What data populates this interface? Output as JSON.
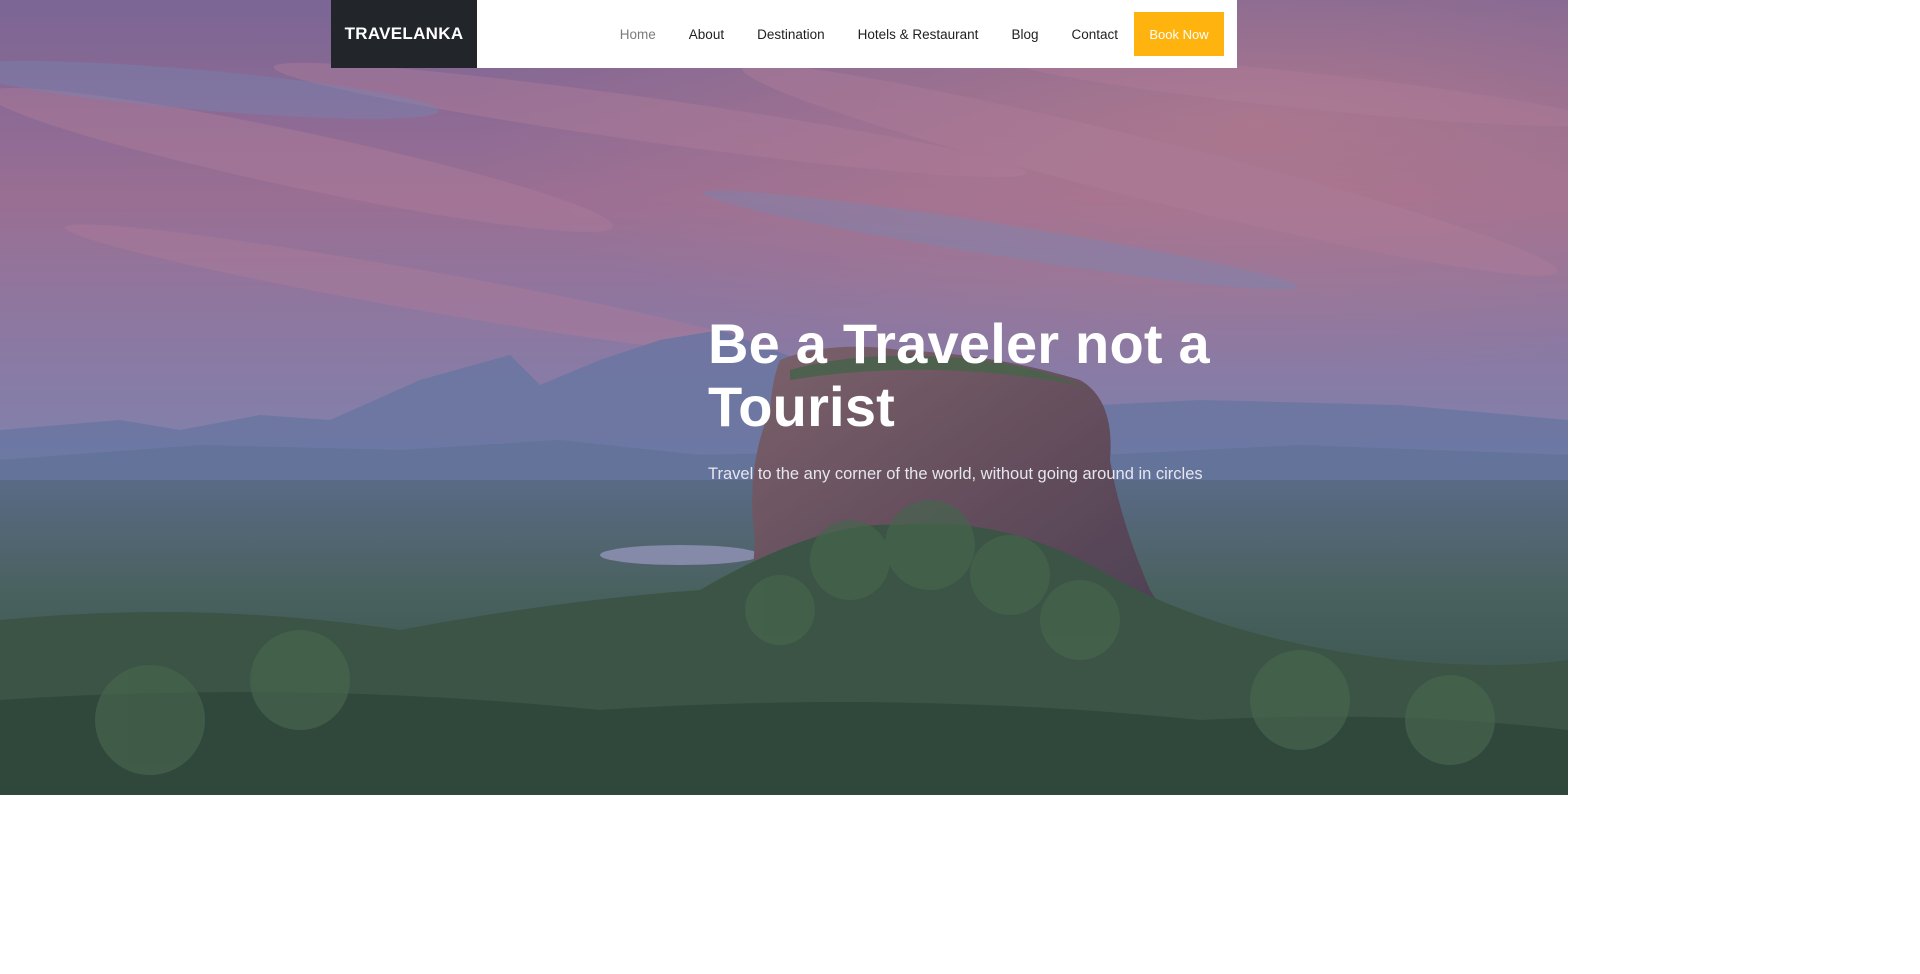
{
  "brand": {
    "name": "TRAVELANKA"
  },
  "nav": {
    "items": [
      {
        "label": "Home",
        "active": true
      },
      {
        "label": "About"
      },
      {
        "label": "Destination"
      },
      {
        "label": "Hotels & Restaurant"
      },
      {
        "label": "Blog"
      },
      {
        "label": "Contact"
      }
    ],
    "cta_label": "Book Now"
  },
  "hero": {
    "title": "Be a Traveler not a Tourist",
    "subtitle": "Travel to the any corner of the world, without going around in circles"
  },
  "colors": {
    "brand_bg": "#22262b",
    "accent": "#ffb30f",
    "nav_text": "#1f1f1f",
    "nav_active": "#7b7b7b"
  }
}
